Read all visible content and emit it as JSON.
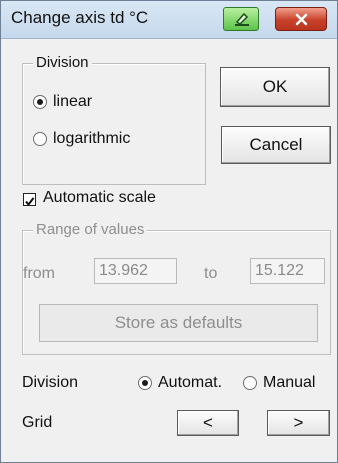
{
  "window": {
    "title": "Change axis td °C",
    "pin_icon": "pin-icon",
    "close_icon": "close-icon"
  },
  "division_group": {
    "legend": "Division",
    "options": [
      {
        "label": "linear",
        "selected": true
      },
      {
        "label": "logarithmic",
        "selected": false
      }
    ]
  },
  "buttons": {
    "ok": "OK",
    "cancel": "Cancel",
    "store_defaults": "Store as defaults",
    "grid_prev": "<",
    "grid_next": ">"
  },
  "automatic_scale": {
    "label": "Automatic scale",
    "checked": true
  },
  "range_group": {
    "legend": "Range of values",
    "from_label": "from",
    "from_value": "13.962",
    "to_label": "to",
    "to_value": "15.122"
  },
  "bottom_division": {
    "label": "Division",
    "options": [
      {
        "label": "Automat.",
        "selected": true
      },
      {
        "label": "Manual",
        "selected": false
      }
    ]
  },
  "grid": {
    "label": "Grid"
  },
  "colors": {
    "title_bar": "#c5d8ec",
    "close_button": "#c8412a",
    "pin_button": "#5ec34a",
    "disabled_text": "#8e8e8e"
  }
}
